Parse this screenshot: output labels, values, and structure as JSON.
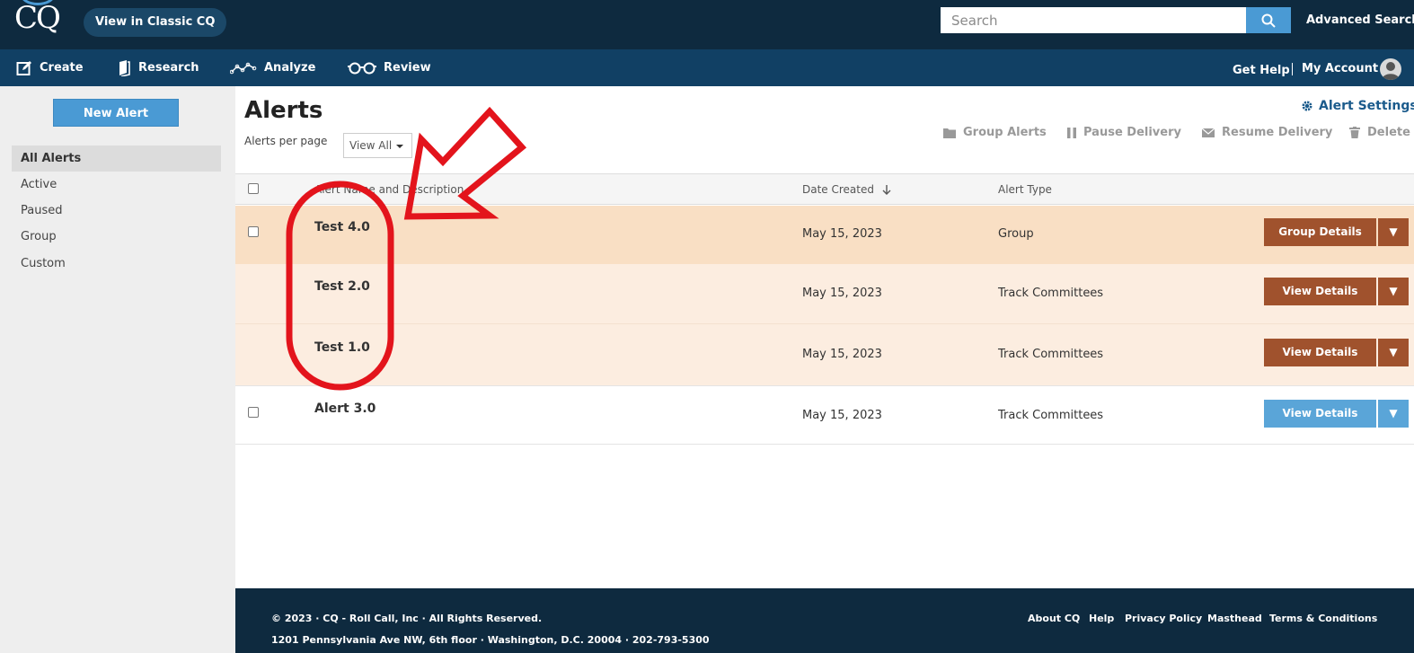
{
  "header": {
    "logo_text": "CQ",
    "classic_button": "View in Classic CQ",
    "search_placeholder": "Search",
    "advanced_search": "Advanced Search"
  },
  "nav": {
    "items": [
      {
        "label": "Create",
        "icon": "edit-icon"
      },
      {
        "label": "Research",
        "icon": "book-icon"
      },
      {
        "label": "Analyze",
        "icon": "analyze-line-icon"
      },
      {
        "label": "Review",
        "icon": "glasses-icon"
      }
    ],
    "get_help": "Get Help",
    "my_account": "My Account"
  },
  "sidebar": {
    "new_alert": "New Alert",
    "items": [
      {
        "label": "All Alerts",
        "active": true
      },
      {
        "label": "Active",
        "active": false
      },
      {
        "label": "Paused",
        "active": false
      },
      {
        "label": "Group",
        "active": false
      },
      {
        "label": "Custom",
        "active": false
      }
    ]
  },
  "main": {
    "title": "Alerts",
    "per_page_label": "Alerts per page",
    "per_page_value": "View All",
    "alert_settings": "Alert Settings",
    "toolbar": {
      "group_alerts": "Group Alerts",
      "pause_delivery": "Pause Delivery",
      "resume_delivery": "Resume Delivery",
      "delete": "Delete"
    }
  },
  "table": {
    "headers": {
      "name": "Alert Name and Description",
      "date": "Date Created",
      "type": "Alert Type"
    },
    "rows": [
      {
        "name": "Test 4.0",
        "date": "May 15, 2023",
        "type": "Group",
        "button": "Group Details",
        "has_checkbox": true
      },
      {
        "name": "Test 2.0",
        "date": "May 15, 2023",
        "type": "Track Committees",
        "button": "View Details",
        "has_checkbox": false
      },
      {
        "name": "Test 1.0",
        "date": "May 15, 2023",
        "type": "Track Committees",
        "button": "View Details",
        "has_checkbox": false
      },
      {
        "name": "Alert 3.0",
        "date": "May 15, 2023",
        "type": "Track Committees",
        "button": "View Details",
        "has_checkbox": true
      }
    ],
    "dropdown_glyph": "▼"
  },
  "footer": {
    "copyright": "© 2023 · CQ - Roll Call, Inc · All Rights Reserved.",
    "address": "1201 Pennsylvania Ave NW, 6th floor · Washington, D.C. 20004 · 202-793-5300",
    "links": [
      "About CQ",
      "Help",
      "Privacy Policy",
      "Masthead",
      "Terms & Conditions"
    ]
  },
  "colors": {
    "header_bg": "#0e2a3f",
    "nav_bg": "#114064",
    "accent_blue": "#4a9ad4",
    "brown_button": "#a0522d",
    "group_row_bg": "#f9dfc4",
    "child_row_bg": "#fcede0",
    "annotation_red": "#e3141c"
  }
}
